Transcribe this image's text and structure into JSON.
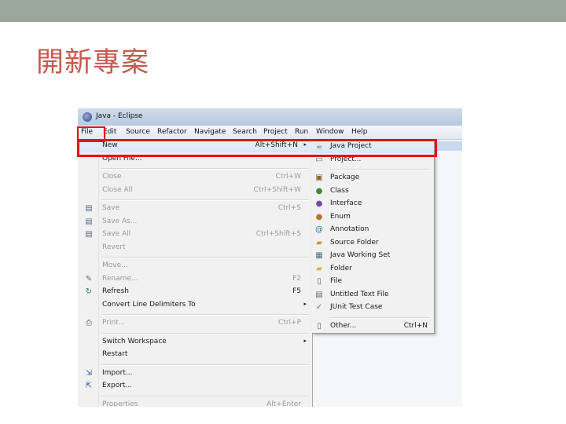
{
  "slide": {
    "title": "開新專案"
  },
  "window": {
    "title": "Java - Eclipse"
  },
  "menubar": [
    "File",
    "Edit",
    "Source",
    "Refactor",
    "Navigate",
    "Search",
    "Project",
    "Run",
    "Window",
    "Help"
  ],
  "file_menu": [
    {
      "label": "New",
      "accel": "Alt+Shift+N",
      "submenu": true,
      "icon": ""
    },
    {
      "label": "Open File...",
      "accel": "",
      "icon": ""
    },
    {
      "separator": true
    },
    {
      "label": "Close",
      "accel": "Ctrl+W",
      "disabled": true,
      "icon": ""
    },
    {
      "label": "Close All",
      "accel": "Ctrl+Shift+W",
      "disabled": true,
      "icon": ""
    },
    {
      "separator": true
    },
    {
      "label": "Save",
      "accel": "Ctrl+S",
      "disabled": true,
      "icon": "save-icon"
    },
    {
      "label": "Save As...",
      "accel": "",
      "disabled": true,
      "icon": "save-as-icon"
    },
    {
      "label": "Save All",
      "accel": "Ctrl+Shift+S",
      "disabled": true,
      "icon": "save-all-icon"
    },
    {
      "label": "Revert",
      "accel": "",
      "disabled": true,
      "icon": ""
    },
    {
      "separator": true
    },
    {
      "label": "Move...",
      "accel": "",
      "disabled": true,
      "icon": ""
    },
    {
      "label": "Rename...",
      "accel": "F2",
      "disabled": true,
      "icon": "rename-icon"
    },
    {
      "label": "Refresh",
      "accel": "F5",
      "icon": "refresh-icon"
    },
    {
      "label": "Convert Line Delimiters To",
      "accel": "",
      "submenu": true,
      "icon": ""
    },
    {
      "separator": true
    },
    {
      "label": "Print...",
      "accel": "Ctrl+P",
      "disabled": true,
      "icon": "print-icon"
    },
    {
      "separator": true
    },
    {
      "label": "Switch Workspace",
      "accel": "",
      "submenu": true,
      "icon": ""
    },
    {
      "label": "Restart",
      "accel": "",
      "icon": ""
    },
    {
      "separator": true
    },
    {
      "label": "Import...",
      "accel": "",
      "icon": "import-icon"
    },
    {
      "label": "Export...",
      "accel": "",
      "icon": "export-icon"
    },
    {
      "separator": true
    },
    {
      "label": "Properties",
      "accel": "Alt+Enter",
      "disabled": true,
      "icon": ""
    }
  ],
  "new_submenu": [
    {
      "label": "Java Project",
      "accel": "",
      "icon": "java-project-icon"
    },
    {
      "label": "Project...",
      "accel": "",
      "icon": "project-icon"
    },
    {
      "separator": true
    },
    {
      "label": "Package",
      "accel": "",
      "icon": "package-icon"
    },
    {
      "label": "Class",
      "accel": "",
      "icon": "class-icon"
    },
    {
      "label": "Interface",
      "accel": "",
      "icon": "interface-icon"
    },
    {
      "label": "Enum",
      "accel": "",
      "icon": "enum-icon"
    },
    {
      "label": "Annotation",
      "accel": "",
      "icon": "annotation-icon"
    },
    {
      "label": "Source Folder",
      "accel": "",
      "icon": "source-folder-icon"
    },
    {
      "label": "Java Working Set",
      "accel": "",
      "icon": "working-set-icon"
    },
    {
      "label": "Folder",
      "accel": "",
      "icon": "folder-icon"
    },
    {
      "label": "File",
      "accel": "",
      "icon": "file-icon"
    },
    {
      "label": "Untitled Text File",
      "accel": "",
      "icon": "text-file-icon"
    },
    {
      "label": "JUnit Test Case",
      "accel": "",
      "icon": "junit-icon"
    },
    {
      "separator": true
    },
    {
      "label": "Other...",
      "accel": "Ctrl+N",
      "icon": "other-icon"
    }
  ],
  "colors": {
    "highlight": "#e01515",
    "title": "#c55a4d",
    "top_bar": "#9ca79c"
  }
}
